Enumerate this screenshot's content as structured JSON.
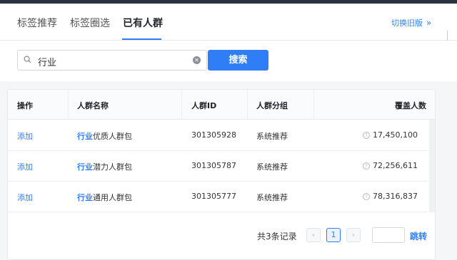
{
  "tabs": [
    {
      "label": "标签推荐"
    },
    {
      "label": "标签圈选"
    },
    {
      "label": "已有人群"
    }
  ],
  "switch_old": {
    "label": "切换旧版",
    "icon": "double-chevron-right-icon"
  },
  "search": {
    "value": "行业",
    "button_label": "搜索",
    "icon": "search-icon",
    "clear_icon": "clear-icon"
  },
  "table": {
    "headers": {
      "action": "操作",
      "name": "人群名称",
      "id": "人群ID",
      "group": "人群分组",
      "coverage": "覆盖人数"
    },
    "rows": [
      {
        "action": "添加",
        "keyword": "行业",
        "name_rest": "优质人群包",
        "id": "301305928",
        "group": "系统推荐",
        "coverage": "17,450,100"
      },
      {
        "action": "添加",
        "keyword": "行业",
        "name_rest": "潜力人群包",
        "id": "301305787",
        "group": "系统推荐",
        "coverage": "72,256,611"
      },
      {
        "action": "添加",
        "keyword": "行业",
        "name_rest": "通用人群包",
        "id": "301305777",
        "group": "系统推荐",
        "coverage": "78,316,837"
      }
    ]
  },
  "pager": {
    "total": "共3条记录",
    "prev": "‹",
    "current": "1",
    "next": "›",
    "jump_label": "跳转"
  },
  "colors": {
    "accent": "#2f7ef5",
    "topbar": "#2b3340"
  }
}
